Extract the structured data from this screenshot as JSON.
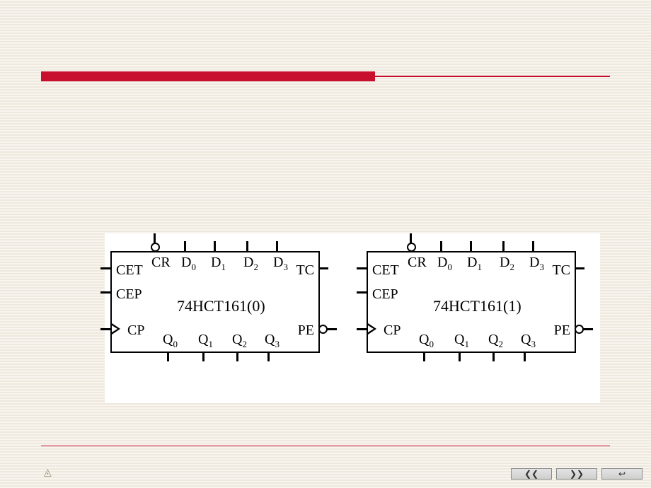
{
  "chips": [
    {
      "name": "74HCT161(0)",
      "left_pins": [
        "CET",
        "CEP",
        "CP"
      ],
      "right_pins": [
        "TC",
        "PE"
      ],
      "top_pins": [
        "CR",
        "D0",
        "D1",
        "D2",
        "D3"
      ],
      "bottom_pins": [
        "Q0",
        "Q1",
        "Q2",
        "Q3"
      ]
    },
    {
      "name": "74HCT161(1)",
      "left_pins": [
        "CET",
        "CEP",
        "CP"
      ],
      "right_pins": [
        "TC",
        "PE"
      ],
      "top_pins": [
        "CR",
        "D0",
        "D1",
        "D2",
        "D3"
      ],
      "bottom_pins": [
        "Q0",
        "Q1",
        "Q2",
        "Q3"
      ]
    }
  ],
  "nav": {
    "prev": "❮❮",
    "next": "❯❯",
    "back": "↩"
  },
  "logo_glyph": "◬"
}
